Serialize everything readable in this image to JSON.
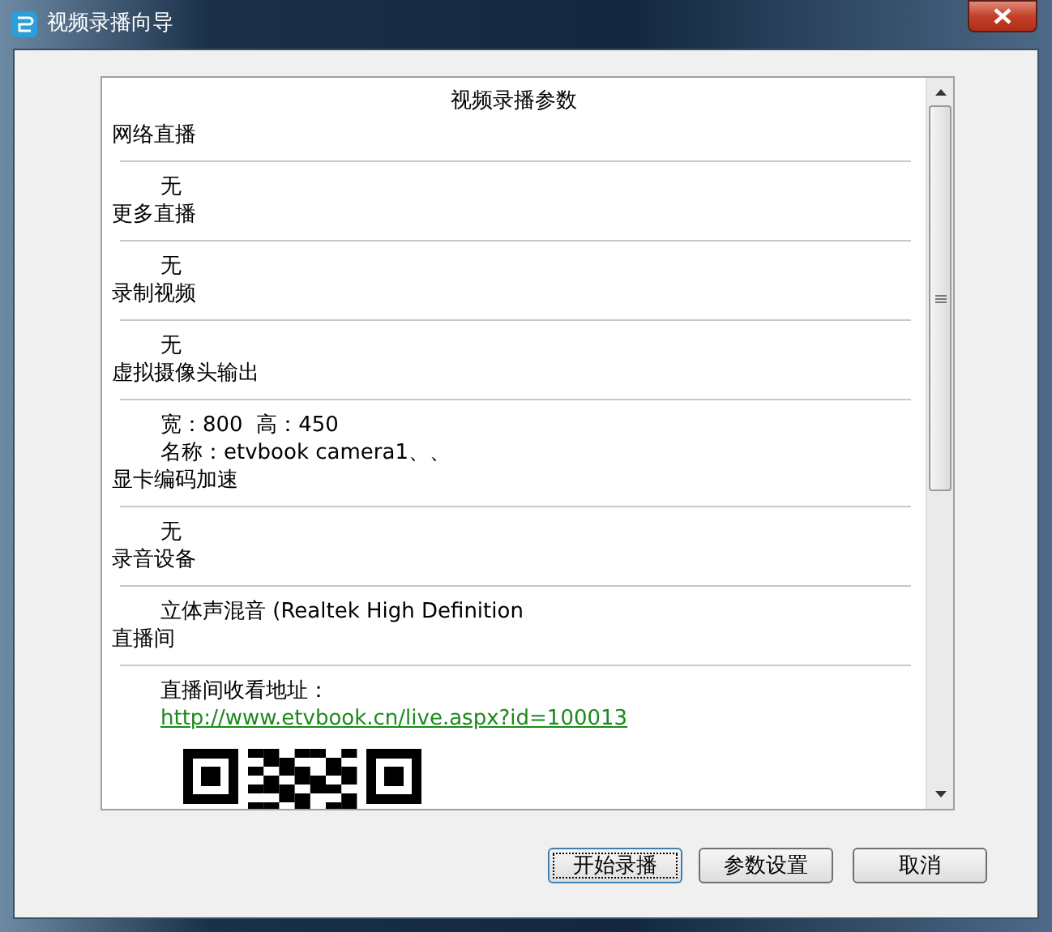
{
  "window": {
    "title": "视频录播向导"
  },
  "panel": {
    "heading": "视频录播参数",
    "sections": [
      {
        "title": "网络直播",
        "values": [
          {
            "kind": "text",
            "text": "无"
          }
        ]
      },
      {
        "title": "更多直播",
        "values": [
          {
            "kind": "text",
            "text": "无"
          }
        ]
      },
      {
        "title": "录制视频",
        "values": [
          {
            "kind": "text",
            "text": "无"
          }
        ]
      },
      {
        "title": "虚拟摄像头输出",
        "values": [
          {
            "kind": "text",
            "text": "宽：800  高：450"
          },
          {
            "kind": "text",
            "text": "名称：etvbook camera1、、"
          }
        ]
      },
      {
        "title": "显卡编码加速",
        "values": [
          {
            "kind": "text",
            "text": "无"
          }
        ]
      },
      {
        "title": "录音设备",
        "values": [
          {
            "kind": "text",
            "text": "立体声混音 (Realtek High Definition"
          }
        ]
      },
      {
        "title": "直播间",
        "values": [
          {
            "kind": "text",
            "text": "直播间收看地址："
          },
          {
            "kind": "link",
            "text": "http://www.etvbook.cn/live.aspx?id=100013"
          },
          {
            "kind": "qr"
          }
        ]
      }
    ]
  },
  "buttons": [
    {
      "label": "开始录播",
      "focused": true
    },
    {
      "label": "参数设置",
      "focused": false
    },
    {
      "label": "取消",
      "focused": false
    }
  ]
}
